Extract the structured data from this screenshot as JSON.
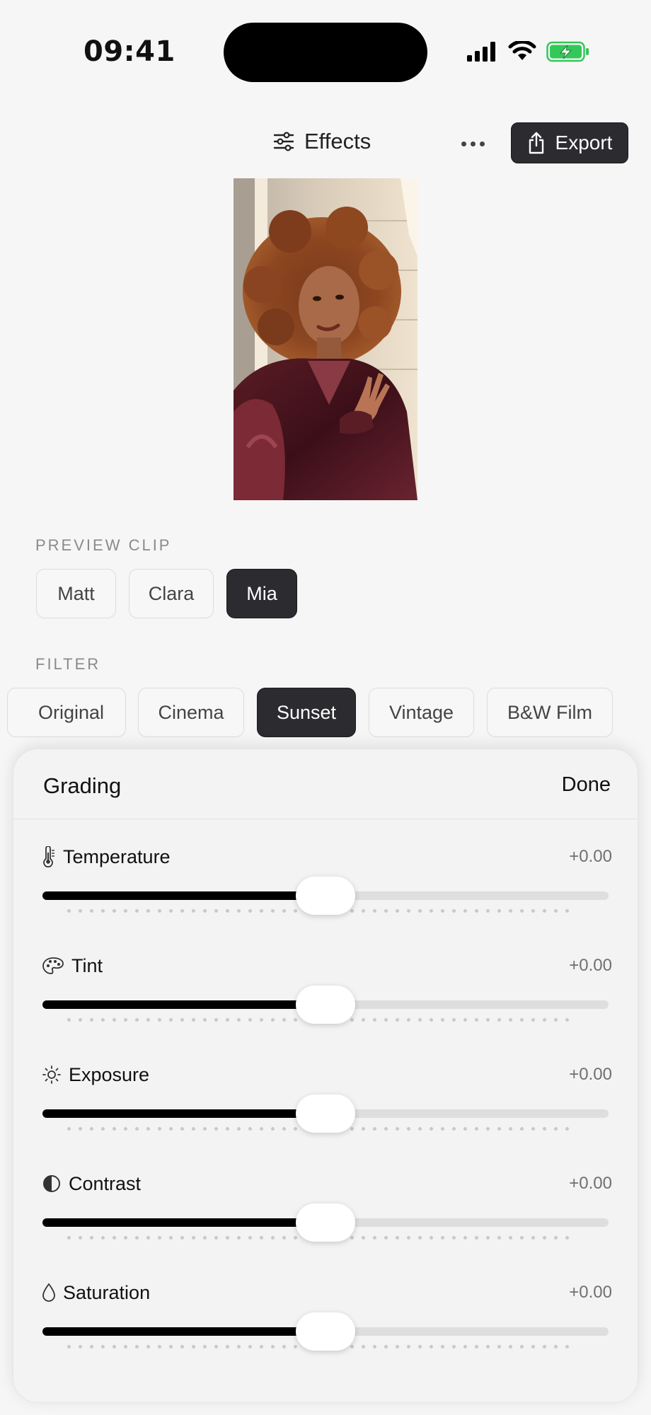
{
  "status": {
    "time": "09:41"
  },
  "header": {
    "title": "Effects",
    "export_label": "Export"
  },
  "preview_clip": {
    "label": "PREVIEW CLIP",
    "options": [
      "Matt",
      "Clara",
      "Mia"
    ],
    "selected": "Mia"
  },
  "filter": {
    "label": "FILTER",
    "options": [
      "Original",
      "Cinema",
      "Sunset",
      "Vintage",
      "B&W Film"
    ],
    "selected": "Sunset"
  },
  "grading": {
    "title": "Grading",
    "done_label": "Done",
    "adjustments": [
      {
        "label": "Temperature",
        "icon": "thermometer-icon",
        "value_text": "+0.00",
        "position": 0.5
      },
      {
        "label": "Tint",
        "icon": "palette-icon",
        "value_text": "+0.00",
        "position": 0.5
      },
      {
        "label": "Exposure",
        "icon": "sun-icon",
        "value_text": "+0.00",
        "position": 0.5
      },
      {
        "label": "Contrast",
        "icon": "contrast-icon",
        "value_text": "+0.00",
        "position": 0.5
      },
      {
        "label": "Saturation",
        "icon": "droplet-icon",
        "value_text": "+0.00",
        "position": 0.5
      }
    ]
  },
  "colors": {
    "accent_dark": "#2c2c30",
    "battery_green": "#34c759"
  }
}
